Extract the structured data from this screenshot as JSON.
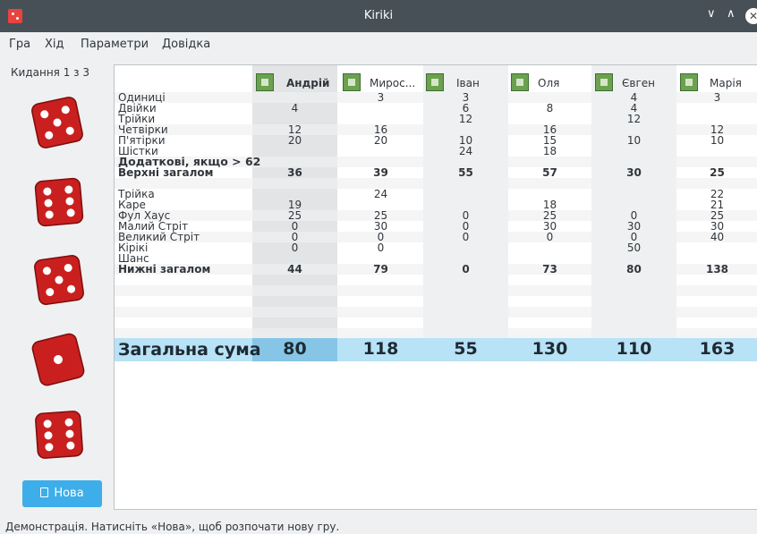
{
  "window": {
    "title": "Kiriki"
  },
  "menu": [
    "Гра",
    "Хід",
    "Параметри",
    "Довідка"
  ],
  "throw_label": "Кидання 1 з 3",
  "dice": [
    {
      "name": "die-1",
      "pips": 5
    },
    {
      "name": "die-2",
      "pips": 6
    },
    {
      "name": "die-3",
      "pips": 5
    },
    {
      "name": "die-4",
      "pips": 1
    },
    {
      "name": "die-5",
      "pips": 6
    }
  ],
  "new_button": "Нова",
  "status_text": "Демонстрація. Натисніть «Нова», щоб розпочати нову гру.",
  "players": [
    "Андрій",
    "Мирос...",
    "Іван",
    "Оля",
    "Євген",
    "Марія"
  ],
  "categories": [
    "Одиниці",
    "Двійки",
    "Трійки",
    "Четвірки",
    "П'ятірки",
    "Шістки",
    "Додаткові, якщо > 62",
    "Верхні загалом",
    "",
    "Трійка",
    "Каре",
    "Фул Хаус",
    "Малий Стріт",
    "Великий Стріт",
    "Кірікі",
    "Шанс",
    "Нижні загалом"
  ],
  "bold_rows": [
    6,
    7,
    16
  ],
  "scores": [
    [
      "",
      "3",
      "3",
      "",
      "4",
      "3"
    ],
    [
      "4",
      "",
      "6",
      "8",
      "4",
      ""
    ],
    [
      "",
      "",
      "12",
      "",
      "12",
      ""
    ],
    [
      "12",
      "16",
      "",
      "16",
      "",
      "12"
    ],
    [
      "20",
      "20",
      "10",
      "15",
      "10",
      "10"
    ],
    [
      "",
      "",
      "24",
      "18",
      "",
      ""
    ],
    [
      "",
      "",
      "",
      "",
      "",
      ""
    ],
    [
      "36",
      "39",
      "55",
      "57",
      "30",
      "25"
    ],
    [
      "",
      "",
      "",
      "",
      "",
      ""
    ],
    [
      "",
      "24",
      "",
      "",
      "",
      "22"
    ],
    [
      "19",
      "",
      "",
      "18",
      "",
      "21"
    ],
    [
      "25",
      "25",
      "0",
      "25",
      "0",
      "25"
    ],
    [
      "0",
      "30",
      "0",
      "30",
      "30",
      "30"
    ],
    [
      "0",
      "0",
      "0",
      "0",
      "0",
      "40"
    ],
    [
      "0",
      "0",
      "",
      "",
      "50",
      ""
    ],
    [
      "",
      "",
      "",
      "",
      "",
      ""
    ],
    [
      "44",
      "79",
      "0",
      "73",
      "80",
      "138"
    ]
  ],
  "grand_total": {
    "label": "Загальна сума",
    "values": [
      "80",
      "118",
      "55",
      "130",
      "110",
      "163"
    ]
  },
  "colors": {
    "accent": "#3daee9",
    "die": "#c9201f",
    "total_row": "#b8e2f6",
    "titlebar": "#475057"
  }
}
